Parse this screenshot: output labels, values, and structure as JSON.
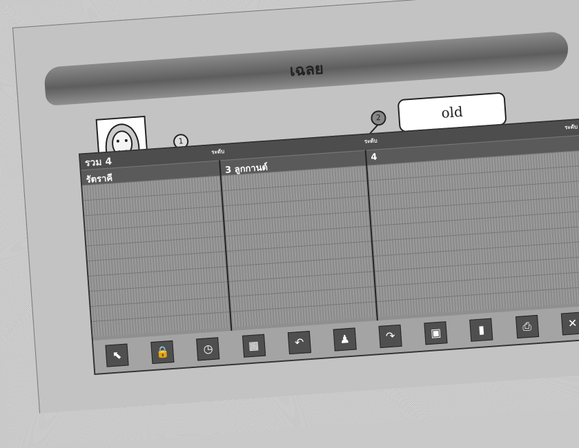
{
  "banner": {
    "title": "เฉลย"
  },
  "callouts": {
    "marker1": "1",
    "marker2": "2",
    "old_label": "old"
  },
  "grid": {
    "count_label": "รวม 4",
    "col_headers": [
      "ระดับ",
      "ระดับ",
      "ระดับ"
    ],
    "selected_row": {
      "col1": "รัตราคี",
      "col2": "3 ลูกกานต์",
      "col3": "4"
    },
    "empty_rows": 10
  },
  "toolbar": {
    "buttons": [
      {
        "icon": "pointer-icon",
        "glyph": "⬉",
        "label": ""
      },
      {
        "icon": "lock-icon",
        "glyph": "🔒",
        "label": ""
      },
      {
        "icon": "clock-icon",
        "glyph": "◷",
        "label": ""
      },
      {
        "icon": "grid-icon",
        "glyph": "▦",
        "label": ""
      },
      {
        "icon": "undo-icon",
        "glyph": "↶",
        "label": ""
      },
      {
        "icon": "person-icon",
        "glyph": "♟",
        "label": ""
      },
      {
        "icon": "redo-icon",
        "glyph": "↷",
        "label": ""
      },
      {
        "icon": "layout-icon",
        "glyph": "▣",
        "label": ""
      },
      {
        "icon": "chart-icon",
        "glyph": "▮",
        "label": ""
      },
      {
        "icon": "print-icon",
        "glyph": "⎙",
        "label": ""
      },
      {
        "icon": "close-icon",
        "glyph": "✕",
        "label": ""
      }
    ]
  }
}
